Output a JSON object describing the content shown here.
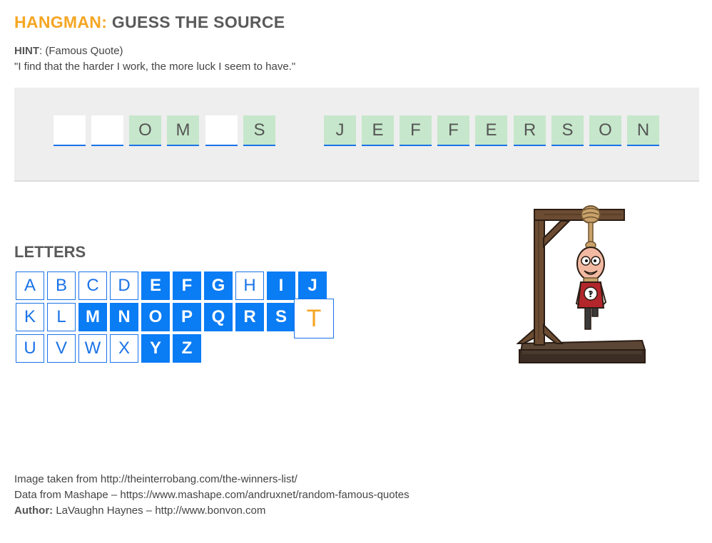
{
  "title": {
    "accent": "HANGMAN:",
    "main": "GUESS THE SOURCE"
  },
  "hint": {
    "label": "HINT",
    "category": ": (Famous Quote)",
    "quote": "\"I find that the harder I work, the more luck I seem to have.\""
  },
  "word": [
    {
      "letter": "",
      "revealed": false
    },
    {
      "letter": "",
      "revealed": false
    },
    {
      "letter": "O",
      "revealed": true
    },
    {
      "letter": "M",
      "revealed": true
    },
    {
      "letter": "",
      "revealed": false
    },
    {
      "letter": "S",
      "revealed": true
    },
    {
      "letter": "J",
      "revealed": true
    },
    {
      "letter": "E",
      "revealed": true
    },
    {
      "letter": "F",
      "revealed": true
    },
    {
      "letter": "F",
      "revealed": true
    },
    {
      "letter": "E",
      "revealed": true
    },
    {
      "letter": "R",
      "revealed": true
    },
    {
      "letter": "S",
      "revealed": true
    },
    {
      "letter": "O",
      "revealed": true
    },
    {
      "letter": "N",
      "revealed": true
    }
  ],
  "letters_heading": "LETTERS",
  "letters": [
    {
      "letter": "A",
      "state": "available"
    },
    {
      "letter": "B",
      "state": "available"
    },
    {
      "letter": "C",
      "state": "available"
    },
    {
      "letter": "D",
      "state": "available"
    },
    {
      "letter": "E",
      "state": "used"
    },
    {
      "letter": "F",
      "state": "used"
    },
    {
      "letter": "G",
      "state": "used"
    },
    {
      "letter": "H",
      "state": "available"
    },
    {
      "letter": "I",
      "state": "used"
    },
    {
      "letter": "J",
      "state": "used"
    },
    {
      "letter": "K",
      "state": "available"
    },
    {
      "letter": "L",
      "state": "available"
    },
    {
      "letter": "M",
      "state": "used"
    },
    {
      "letter": "N",
      "state": "used"
    },
    {
      "letter": "O",
      "state": "used"
    },
    {
      "letter": "P",
      "state": "used"
    },
    {
      "letter": "Q",
      "state": "used"
    },
    {
      "letter": "R",
      "state": "used"
    },
    {
      "letter": "S",
      "state": "used"
    },
    {
      "letter": "T",
      "state": "active"
    },
    {
      "letter": "U",
      "state": "available"
    },
    {
      "letter": "V",
      "state": "available"
    },
    {
      "letter": "W",
      "state": "available"
    },
    {
      "letter": "X",
      "state": "available"
    },
    {
      "letter": "Y",
      "state": "used"
    },
    {
      "letter": "Z",
      "state": "used"
    }
  ],
  "colors": {
    "accent": "#f5a623",
    "key_blue": "#0a7cf4",
    "revealed_tile": "#c6e7cb",
    "panel_bg": "#eeeeee"
  },
  "footer": {
    "line1": "Image taken from http://theinterrobang.com/the-winners-list/",
    "line2": "Data from Mashape – https://www.mashape.com/andruxnet/random-famous-quotes",
    "author_label": "Author:",
    "author_value": " LaVaughn Haynes – http://www.bonvon.com"
  }
}
